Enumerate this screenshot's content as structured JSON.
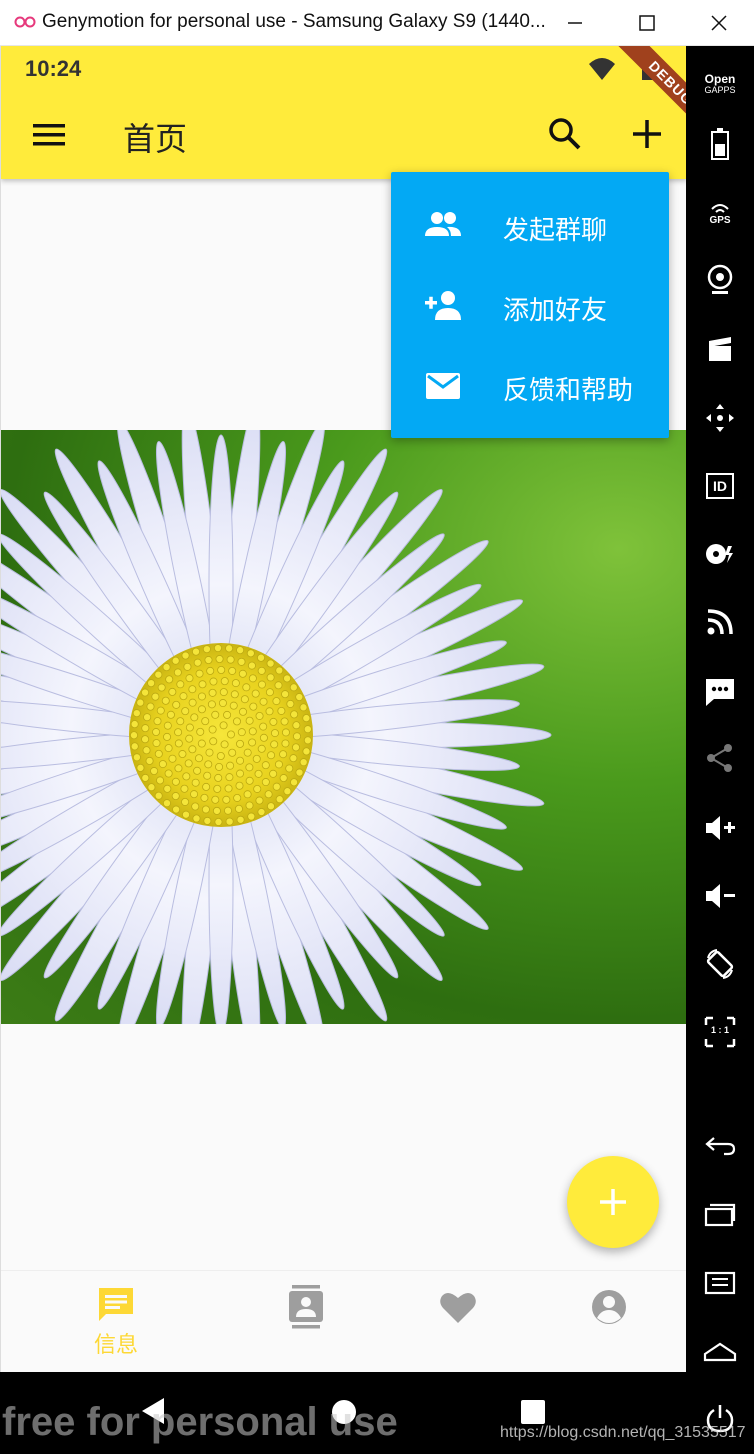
{
  "window": {
    "title": "Genymotion for personal use - Samsung Galaxy S9 (1440...",
    "minimize_icon": "minimize-icon",
    "maximize_icon": "maximize-icon",
    "close_icon": "close-icon"
  },
  "status_bar": {
    "time": "10:24",
    "debug_label": "DEBUG"
  },
  "app_bar": {
    "title": "首页",
    "menu_icon": "menu-icon",
    "search_icon": "search-icon",
    "add_icon": "add-icon",
    "color": "#ffeb3b"
  },
  "popup_menu": {
    "color": "#03a9f4",
    "items": [
      {
        "icon": "group-icon",
        "label": "发起群聊"
      },
      {
        "icon": "person-add-icon",
        "label": "添加好友"
      },
      {
        "icon": "mail-icon",
        "label": "反馈和帮助"
      }
    ]
  },
  "fab": {
    "icon": "add-icon",
    "color": "#ffeb3b"
  },
  "bottom_nav": {
    "active_color": "#fdd835",
    "inactive_color": "#9e9e9e",
    "items": [
      {
        "icon": "chat-icon",
        "label": "信息",
        "active": true
      },
      {
        "icon": "contacts-icon",
        "label": "",
        "active": false
      },
      {
        "icon": "heart-icon",
        "label": "",
        "active": false
      },
      {
        "icon": "account-icon",
        "label": "",
        "active": false
      }
    ]
  },
  "genymotion_sidebar": {
    "open_gapps_line1": "Open",
    "open_gapps_line2": "GAPPS",
    "gps_label": "GPS",
    "id_label": "ID",
    "scale_label": "1 : 1"
  },
  "watermark": "free for personal use",
  "url_watermark": "https://blog.csdn.net/qq_31535517"
}
